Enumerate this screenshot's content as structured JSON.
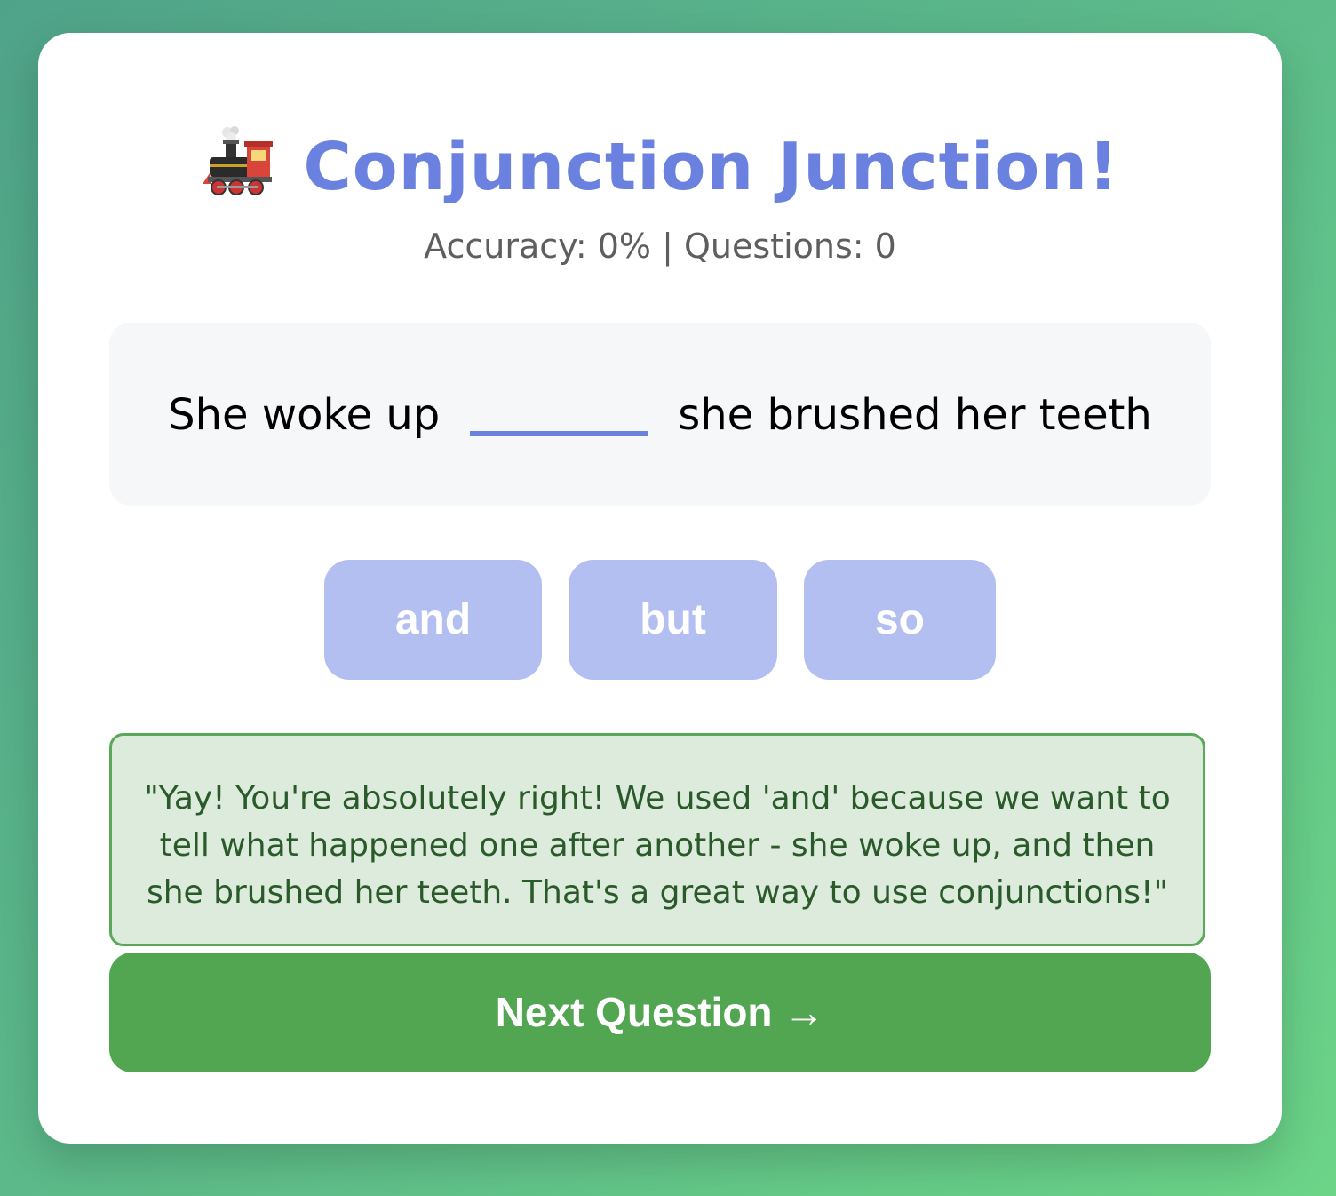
{
  "header": {
    "title": "Conjunction Junction!",
    "icon": "steam-locomotive-icon"
  },
  "stats": {
    "text": "Accuracy: 0% | Questions: 0"
  },
  "question": {
    "before_blank": "She woke up",
    "after_blank": "she brushed her teeth"
  },
  "options": [
    {
      "label": "and"
    },
    {
      "label": "but"
    },
    {
      "label": "so"
    }
  ],
  "feedback": {
    "text": "\"Yay! You're absolutely right! We used 'and' because we want to tell what happened one after another - she woke up, and then she brushed her teeth. That's a great way to use conjunctions!\""
  },
  "next_button": {
    "label": "Next Question →"
  },
  "colors": {
    "accent": "#6b81e0",
    "option_bg": "#b3bff0",
    "success": "#53a651",
    "feedback_bg": "#dcebdc",
    "feedback_text": "#2a5a2a"
  }
}
